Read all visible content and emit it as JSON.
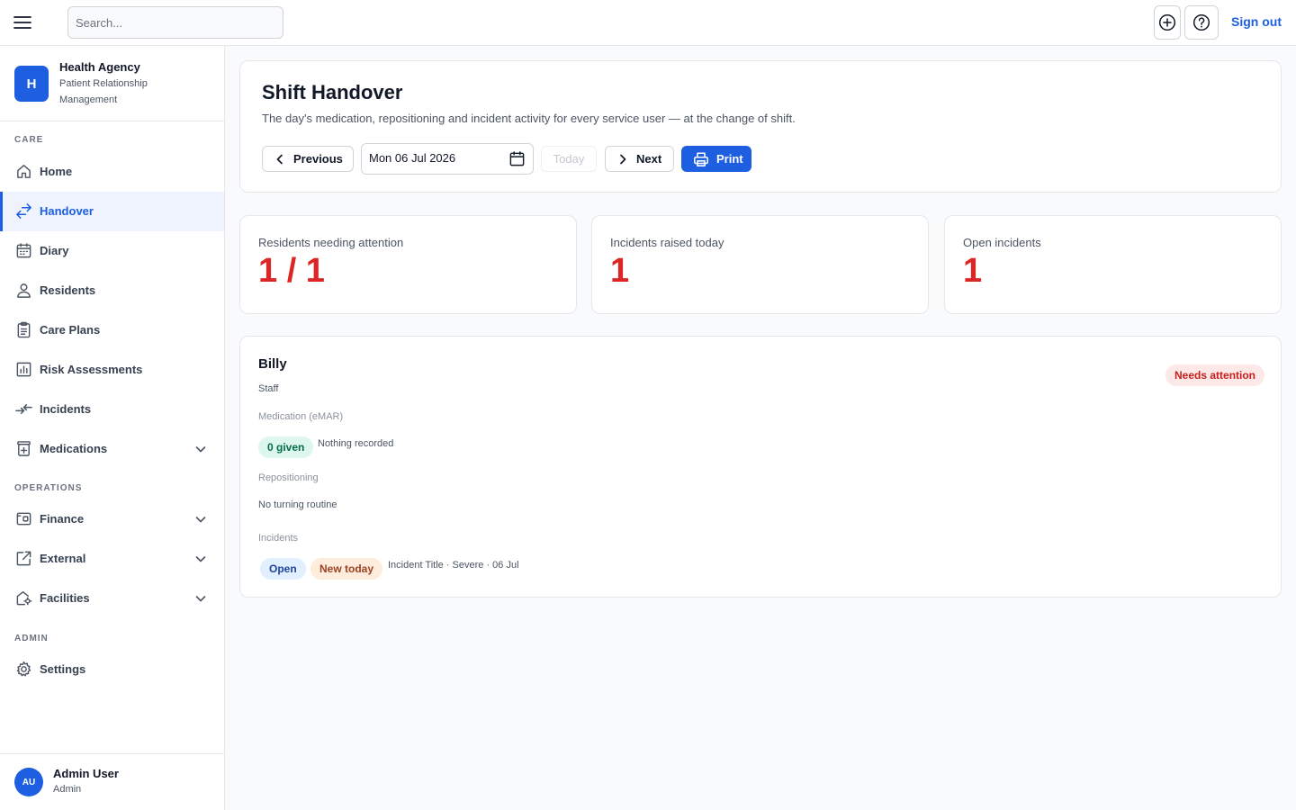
{
  "topbar": {
    "search_placeholder": "Search...",
    "sign_out": "Sign out",
    "icons": {
      "menu": "menu-icon",
      "add": "plus-circle-icon",
      "help": "help-circle-icon"
    }
  },
  "sidebar": {
    "brand": {
      "initial": "H",
      "name": "Health Agency",
      "subtitle": "Patient Relationship Management"
    },
    "sections": {
      "care": "CARE",
      "operations": "OPERATIONS",
      "admin": "ADMIN"
    },
    "items": [
      {
        "label": "Home",
        "icon": "home-icon"
      },
      {
        "label": "Handover",
        "icon": "arrows-exchange-icon",
        "active": true
      },
      {
        "label": "Diary",
        "icon": "calendar-icon"
      },
      {
        "label": "Residents",
        "icon": "user-icon"
      },
      {
        "label": "Care Plans",
        "icon": "clipboard-icon"
      },
      {
        "label": "Risk Assessments",
        "icon": "chart-icon"
      },
      {
        "label": "Incidents",
        "icon": "arrows-in-icon"
      },
      {
        "label": "Medications",
        "icon": "medicine-icon",
        "expandable": true
      },
      {
        "label": "Finance",
        "icon": "wallet-icon",
        "expandable": true
      },
      {
        "label": "External",
        "icon": "external-link-icon",
        "expandable": true
      },
      {
        "label": "Facilities",
        "icon": "building-icon",
        "expandable": true
      },
      {
        "label": "Settings",
        "icon": "gear-icon"
      }
    ],
    "user": {
      "initials": "AU",
      "name": "Admin User",
      "role": "Admin"
    }
  },
  "header": {
    "title": "Shift Handover",
    "description": "The day's medication, repositioning and incident activity for every service user — at the change of shift.",
    "previous": "Previous",
    "date": "Mon 06 Jul 2026",
    "today": "Today",
    "next": "Next",
    "print": "Print"
  },
  "stats": [
    {
      "label": "Residents needing attention",
      "value": "1 / 1"
    },
    {
      "label": "Incidents raised today",
      "value": "1"
    },
    {
      "label": "Open incidents",
      "value": "1"
    }
  ],
  "resident": {
    "name": "Billy",
    "role": "Staff",
    "status": "Needs attention",
    "medication_label": "Medication (eMAR)",
    "medication_given": "0 given",
    "medication_note": "Nothing recorded",
    "repositioning_label": "Repositioning",
    "repositioning_note": "No turning routine",
    "incidents_label": "Incidents",
    "incident_status": "Open",
    "incident_flag": "New today",
    "incident_detail": "Incident Title · Severe · 06 Jul"
  },
  "colors": {
    "accent": "#1d5fe0",
    "danger": "#dc2626"
  }
}
